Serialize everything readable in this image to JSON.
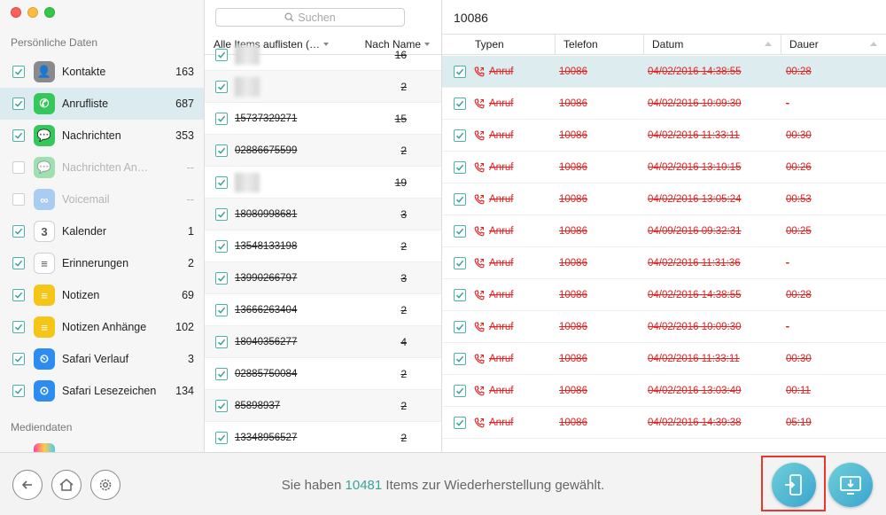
{
  "window": {
    "traffic_lights": [
      "close",
      "minimize",
      "zoom"
    ]
  },
  "sidebar": {
    "section_personal": "Persönliche Daten",
    "section_media": "Mediendaten",
    "items": [
      {
        "label": "Kontakte",
        "count": "163",
        "checked": true,
        "disabled": false,
        "active": false,
        "icon": "contacts-icon",
        "color": "#8a8a8a"
      },
      {
        "label": "Anrufliste",
        "count": "687",
        "checked": true,
        "disabled": false,
        "active": true,
        "icon": "phone-icon",
        "color": "#34c759"
      },
      {
        "label": "Nachrichten",
        "count": "353",
        "checked": true,
        "disabled": false,
        "active": false,
        "icon": "messages-icon",
        "color": "#34c759"
      },
      {
        "label": "Nachrichten An…",
        "count": "--",
        "checked": false,
        "disabled": true,
        "active": false,
        "icon": "message-attachment-icon",
        "color": "#34c759"
      },
      {
        "label": "Voicemail",
        "count": "--",
        "checked": false,
        "disabled": true,
        "active": false,
        "icon": "voicemail-icon",
        "color": "#4a9ce8"
      },
      {
        "label": "Kalender",
        "count": "1",
        "checked": true,
        "disabled": false,
        "active": false,
        "icon": "calendar-icon",
        "color": "#ffffff"
      },
      {
        "label": "Erinnerungen",
        "count": "2",
        "checked": true,
        "disabled": false,
        "active": false,
        "icon": "reminders-icon",
        "color": "#ffffff"
      },
      {
        "label": "Notizen",
        "count": "69",
        "checked": true,
        "disabled": false,
        "active": false,
        "icon": "notes-icon",
        "color": "#f5c518"
      },
      {
        "label": "Notizen Anhänge",
        "count": "102",
        "checked": true,
        "disabled": false,
        "active": false,
        "icon": "notes-attachment-icon",
        "color": "#f5c518"
      },
      {
        "label": "Safari Verlauf",
        "count": "3",
        "checked": true,
        "disabled": false,
        "active": false,
        "icon": "safari-history-icon",
        "color": "#2d8cf0"
      },
      {
        "label": "Safari Lesezeichen",
        "count": "134",
        "checked": true,
        "disabled": false,
        "active": false,
        "icon": "safari-bookmark-icon",
        "color": "#2d8cf0"
      }
    ]
  },
  "middle": {
    "search_placeholder": "Suchen",
    "col_left": "Alle Items auflisten (…",
    "col_right": "Nach Name",
    "rows": [
      {
        "name": "",
        "count": "16",
        "blur": true
      },
      {
        "name": "",
        "count": "2",
        "blur": true
      },
      {
        "name": "15737329271",
        "count": "15",
        "blur": false
      },
      {
        "name": "02886675599",
        "count": "2",
        "blur": false
      },
      {
        "name": "",
        "count": "19",
        "blur": true
      },
      {
        "name": "18080998681",
        "count": "3",
        "blur": false
      },
      {
        "name": "13548133198",
        "count": "2",
        "blur": false
      },
      {
        "name": "13990266797",
        "count": "3",
        "blur": false
      },
      {
        "name": "13666263404",
        "count": "2",
        "blur": false
      },
      {
        "name": "18040356277",
        "count": "4",
        "blur": false
      },
      {
        "name": "02885750084",
        "count": "2",
        "blur": false
      },
      {
        "name": "85898937",
        "count": "2",
        "blur": false
      },
      {
        "name": "13348956527",
        "count": "2",
        "blur": false
      }
    ]
  },
  "right": {
    "title": "10086",
    "columns": [
      "Typen",
      "Telefon",
      "Datum",
      "Dauer"
    ],
    "rows": [
      {
        "type": "Anruf",
        "tel": "10086",
        "date": "04/02/2016 14:38:55",
        "dur": "00:28",
        "selected": true
      },
      {
        "type": "Anruf",
        "tel": "10086",
        "date": "04/02/2016 10:09:30",
        "dur": "-",
        "selected": false
      },
      {
        "type": "Anruf",
        "tel": "10086",
        "date": "04/02/2016 11:33:11",
        "dur": "00:30",
        "selected": false
      },
      {
        "type": "Anruf",
        "tel": "10086",
        "date": "04/02/2016 13:10:15",
        "dur": "00:26",
        "selected": false
      },
      {
        "type": "Anruf",
        "tel": "10086",
        "date": "04/02/2016 13:05:24",
        "dur": "00:53",
        "selected": false
      },
      {
        "type": "Anruf",
        "tel": "10086",
        "date": "04/09/2016 09:32:31",
        "dur": "00:25",
        "selected": false
      },
      {
        "type": "Anruf",
        "tel": "10086",
        "date": "04/02/2016 11:31:36",
        "dur": "-",
        "selected": false
      },
      {
        "type": "Anruf",
        "tel": "10086",
        "date": "04/02/2016 14:38:55",
        "dur": "00:28",
        "selected": false
      },
      {
        "type": "Anruf",
        "tel": "10086",
        "date": "04/02/2016 10:09:30",
        "dur": "-",
        "selected": false
      },
      {
        "type": "Anruf",
        "tel": "10086",
        "date": "04/02/2016 11:33:11",
        "dur": "00:30",
        "selected": false
      },
      {
        "type": "Anruf",
        "tel": "10086",
        "date": "04/02/2016 13:03:49",
        "dur": "00:11",
        "selected": false
      },
      {
        "type": "Anruf",
        "tel": "10086",
        "date": "04/02/2016 14:39:38",
        "dur": "05:19",
        "selected": false
      }
    ]
  },
  "footer": {
    "status_prefix": "Sie haben",
    "status_count": "10481",
    "status_suffix": "Items zur Wiederherstellung gewählt.",
    "accent_color": "#3aa29a"
  }
}
